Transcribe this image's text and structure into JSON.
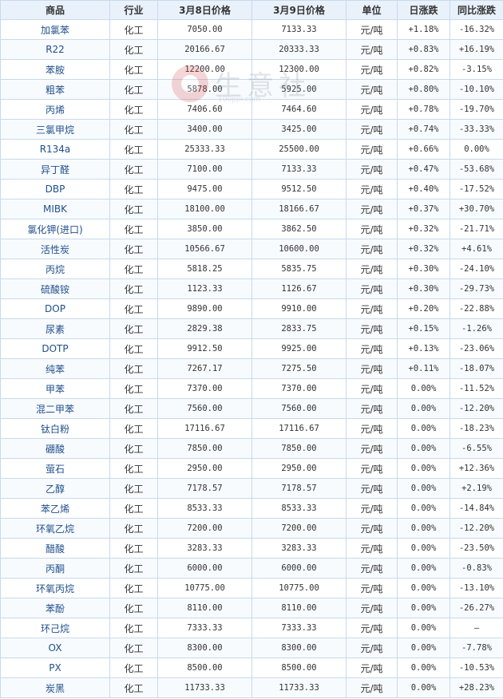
{
  "table": {
    "headers": [
      "商品",
      "行业",
      "3月8日价格",
      "3月9日价格",
      "单位",
      "日涨跌",
      "同比涨跌"
    ],
    "rows": [
      [
        "加氯苯",
        "化工",
        "7050.00",
        "7133.33",
        "元/吨",
        "+1.18%",
        "-16.32%"
      ],
      [
        "R22",
        "化工",
        "20166.67",
        "20333.33",
        "元/吨",
        "+0.83%",
        "+16.19%"
      ],
      [
        "苯胺",
        "化工",
        "12200.00",
        "12300.00",
        "元/吨",
        "+0.82%",
        "-3.15%"
      ],
      [
        "粗苯",
        "化工",
        "5878.00",
        "5925.00",
        "元/吨",
        "+0.80%",
        "-10.10%"
      ],
      [
        "丙烯",
        "化工",
        "7406.60",
        "7464.60",
        "元/吨",
        "+0.78%",
        "-19.70%"
      ],
      [
        "三氯甲烷",
        "化工",
        "3400.00",
        "3425.00",
        "元/吨",
        "+0.74%",
        "-33.33%"
      ],
      [
        "R134a",
        "化工",
        "25333.33",
        "25500.00",
        "元/吨",
        "+0.66%",
        "0.00%"
      ],
      [
        "异丁醛",
        "化工",
        "7100.00",
        "7133.33",
        "元/吨",
        "+0.47%",
        "-53.68%"
      ],
      [
        "DBP",
        "化工",
        "9475.00",
        "9512.50",
        "元/吨",
        "+0.40%",
        "-17.52%"
      ],
      [
        "MIBK",
        "化工",
        "18100.00",
        "18166.67",
        "元/吨",
        "+0.37%",
        "+30.70%"
      ],
      [
        "氯化钾(进口)",
        "化工",
        "3850.00",
        "3862.50",
        "元/吨",
        "+0.32%",
        "-21.71%"
      ],
      [
        "活性炭",
        "化工",
        "10566.67",
        "10600.00",
        "元/吨",
        "+0.32%",
        "+4.61%"
      ],
      [
        "丙烷",
        "化工",
        "5818.25",
        "5835.75",
        "元/吨",
        "+0.30%",
        "-24.10%"
      ],
      [
        "硫酸铵",
        "化工",
        "1123.33",
        "1126.67",
        "元/吨",
        "+0.30%",
        "-29.73%"
      ],
      [
        "DOP",
        "化工",
        "9890.00",
        "9910.00",
        "元/吨",
        "+0.20%",
        "-22.88%"
      ],
      [
        "尿素",
        "化工",
        "2829.38",
        "2833.75",
        "元/吨",
        "+0.15%",
        "-1.26%"
      ],
      [
        "DOTP",
        "化工",
        "9912.50",
        "9925.00",
        "元/吨",
        "+0.13%",
        "-23.06%"
      ],
      [
        "纯苯",
        "化工",
        "7267.17",
        "7275.50",
        "元/吨",
        "+0.11%",
        "-18.07%"
      ],
      [
        "甲苯",
        "化工",
        "7370.00",
        "7370.00",
        "元/吨",
        "0.00%",
        "-11.52%"
      ],
      [
        "混二甲苯",
        "化工",
        "7560.00",
        "7560.00",
        "元/吨",
        "0.00%",
        "-12.20%"
      ],
      [
        "钛白粉",
        "化工",
        "17116.67",
        "17116.67",
        "元/吨",
        "0.00%",
        "-18.23%"
      ],
      [
        "硼酸",
        "化工",
        "7850.00",
        "7850.00",
        "元/吨",
        "0.00%",
        "-6.55%"
      ],
      [
        "萤石",
        "化工",
        "2950.00",
        "2950.00",
        "元/吨",
        "0.00%",
        "+12.36%"
      ],
      [
        "乙醇",
        "化工",
        "7178.57",
        "7178.57",
        "元/吨",
        "0.00%",
        "+2.19%"
      ],
      [
        "苯乙烯",
        "化工",
        "8533.33",
        "8533.33",
        "元/吨",
        "0.00%",
        "-14.84%"
      ],
      [
        "环氧乙烷",
        "化工",
        "7200.00",
        "7200.00",
        "元/吨",
        "0.00%",
        "-12.20%"
      ],
      [
        "醋酸",
        "化工",
        "3283.33",
        "3283.33",
        "元/吨",
        "0.00%",
        "-23.50%"
      ],
      [
        "丙酮",
        "化工",
        "6000.00",
        "6000.00",
        "元/吨",
        "0.00%",
        "-0.83%"
      ],
      [
        "环氧丙烷",
        "化工",
        "10775.00",
        "10775.00",
        "元/吨",
        "0.00%",
        "-13.10%"
      ],
      [
        "苯酚",
        "化工",
        "8110.00",
        "8110.00",
        "元/吨",
        "0.00%",
        "-26.27%"
      ],
      [
        "环己烷",
        "化工",
        "7333.33",
        "7333.33",
        "元/吨",
        "0.00%",
        "—"
      ],
      [
        "OX",
        "化工",
        "8300.00",
        "8300.00",
        "元/吨",
        "0.00%",
        "-7.78%"
      ],
      [
        "PX",
        "化工",
        "8500.00",
        "8500.00",
        "元/吨",
        "0.00%",
        "-10.53%"
      ],
      [
        "炭黑",
        "化工",
        "11733.33",
        "11733.33",
        "元/吨",
        "0.00%",
        "+28.23%"
      ]
    ]
  },
  "watermark": {
    "text": "生意社",
    "sub": "100ppi.com"
  },
  "colors": {
    "up": "#e23b3b",
    "down": "#2a8a2a",
    "header_bg": "#e9f1fb",
    "border": "#c9d9ec",
    "name_link": "#1f4f8b"
  }
}
